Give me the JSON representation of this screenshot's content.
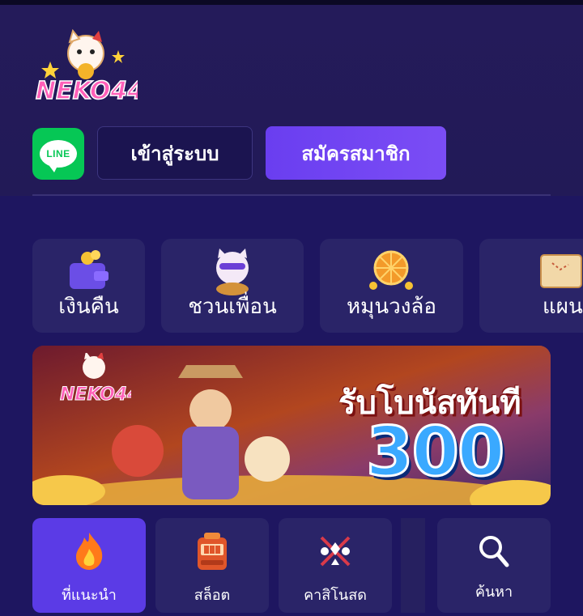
{
  "header": {
    "logo_text": "NEKO44",
    "line_label": "LINE",
    "login_label": "เข้าสู่ระบบ",
    "register_label": "สมัครสมาชิก"
  },
  "quick_menu": [
    {
      "label": "เงินคืน",
      "icon": "wallet-coins-icon"
    },
    {
      "label": "ชวนเพื่อน",
      "icon": "lucky-cat-icon"
    },
    {
      "label": "หมุนวงล้อ",
      "icon": "spin-wheel-icon"
    },
    {
      "label": "แผน",
      "icon": "map-scroll-icon"
    }
  ],
  "banner": {
    "logo_text": "NEKO44",
    "title": "รับโบนัสทันที",
    "amount": "300"
  },
  "tabs": [
    {
      "label": "ที่แนะนำ",
      "icon": "fire-icon",
      "active": true
    },
    {
      "label": "สล็อต",
      "icon": "slot-machine-icon",
      "active": false
    },
    {
      "label": "คาสิโนสด",
      "icon": "card-suits-icon",
      "active": false
    },
    {
      "label": "ค้นหา",
      "icon": "search-icon",
      "active": false
    }
  ],
  "colors": {
    "background": "#1e1660",
    "card": "#2a2468",
    "accent": "#6a3ef0",
    "line_green": "#06c755"
  }
}
